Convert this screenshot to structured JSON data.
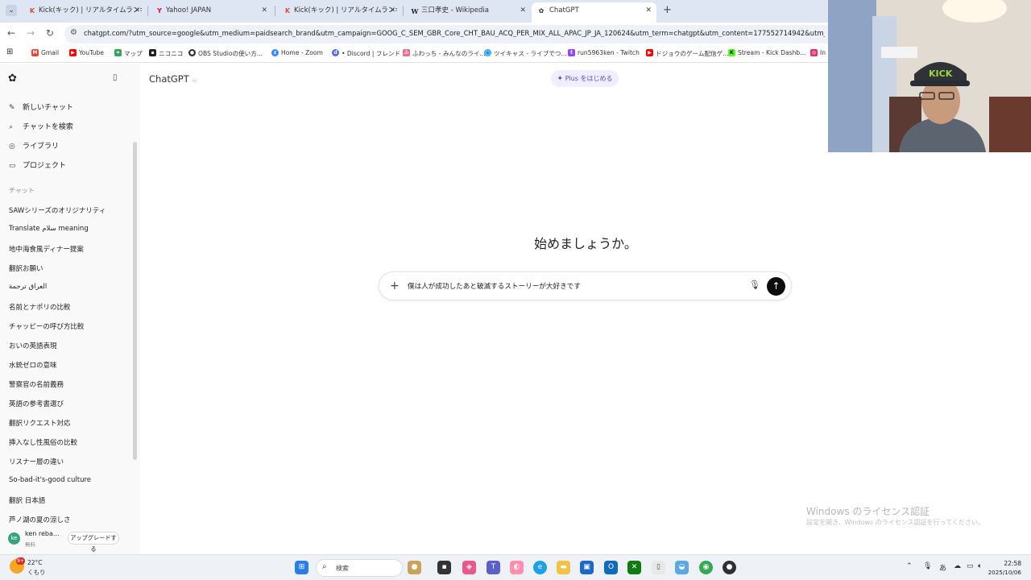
{
  "browser": {
    "tabs": [
      {
        "title": "Kick(キック) | リアルタイムランキング",
        "icon": "kick-favicon-icon",
        "active": false
      },
      {
        "title": "Yahoo! JAPAN",
        "icon": "yahoo-favicon-icon",
        "active": false
      },
      {
        "title": "Kick(キック) | リアルタイムランキング",
        "icon": "kick-favicon-icon",
        "active": false
      },
      {
        "title": "三口孝史 - Wikipedia",
        "icon": "wikipedia-favicon-icon",
        "active": false
      },
      {
        "title": "ChatGPT",
        "icon": "chatgpt-favicon-icon",
        "active": true
      }
    ],
    "url": "chatgpt.com/?utm_source=google&utm_medium=paidsearch_brand&utm_campaign=GOOG_C_SEM_GBR_Core_CHT_BAU_ACQ_PER_MIX_ALL_APAC_JP_JA_120624&utm_term=chatgpt&utm_content=177552714942&utm_ad=",
    "bookmarks": [
      {
        "label": "Gmail",
        "color": "#ea4335"
      },
      {
        "label": "YouTube",
        "color": "#ff0000"
      },
      {
        "label": "マップ",
        "color": "#34a853"
      },
      {
        "label": "ニコニコ",
        "color": "#222222"
      },
      {
        "label": "OBS Studioの使い方...",
        "color": "#302e31"
      },
      {
        "label": "Home - Zoom",
        "color": "#2d8cff"
      },
      {
        "label": "• Discord | フレンド",
        "color": "#5865f2"
      },
      {
        "label": "ふわっち - みんなのライ...",
        "color": "#f06a8a"
      },
      {
        "label": "ツイキャス - ライブでつ...",
        "color": "#1da1f2"
      },
      {
        "label": "run5963ken - Twitch",
        "color": "#9146ff"
      },
      {
        "label": "ドジョウのゲーム配信ゲ...",
        "color": "#ff0000"
      },
      {
        "label": "Stream - Kick Dashb...",
        "color": "#53fc18"
      },
      {
        "label": "In",
        "color": "#e1306c"
      }
    ]
  },
  "sidebar": {
    "nav": [
      {
        "label": "新しいチャット",
        "icon": "new-chat-icon"
      },
      {
        "label": "チャットを検索",
        "icon": "search-icon"
      },
      {
        "label": "ライブラリ",
        "icon": "library-icon"
      },
      {
        "label": "プロジェクト",
        "icon": "folder-icon"
      }
    ],
    "section_label": "チャット",
    "chats": [
      "SAWシリーズのオリジナリティ",
      "Translate سلام meaning",
      "地中海食風ディナー提案",
      "翻訳お願い",
      "العراق ترجمة",
      "名前とナポリの比較",
      "チャッピーの呼び方比較",
      "おいの英語表現",
      "水銃ゼロの意味",
      "警察官の名前義務",
      "英語の参考書選び",
      "翻訳リクエスト対応",
      "挿入なし性風俗の比較",
      "リスナー層の違い",
      "So-bad-it's-good culture",
      "翻訳 日本語",
      "芦ノ湖の夏の涼しさ"
    ],
    "user": {
      "name": "ken reba...",
      "plan": "無料",
      "avatar_initial": "ke"
    },
    "upgrade_label": "アップグレードする"
  },
  "main": {
    "model_name": "ChatGPT",
    "plus_label": "Plus をはじめる",
    "heading": "始めましょうか。",
    "composer_text": "僕は人が成功したあと破滅するストーリーが大好きです"
  },
  "windows": {
    "watermark_title": "Windows のライセンス認証",
    "watermark_sub": "設定を開き、Windows のライセンス認証を行ってください。",
    "weather_temp": "22°C",
    "weather_cond": "くもり",
    "weather_badge": "9+",
    "search_label": "検索",
    "time": "22:58",
    "date": "2025/10/06"
  }
}
